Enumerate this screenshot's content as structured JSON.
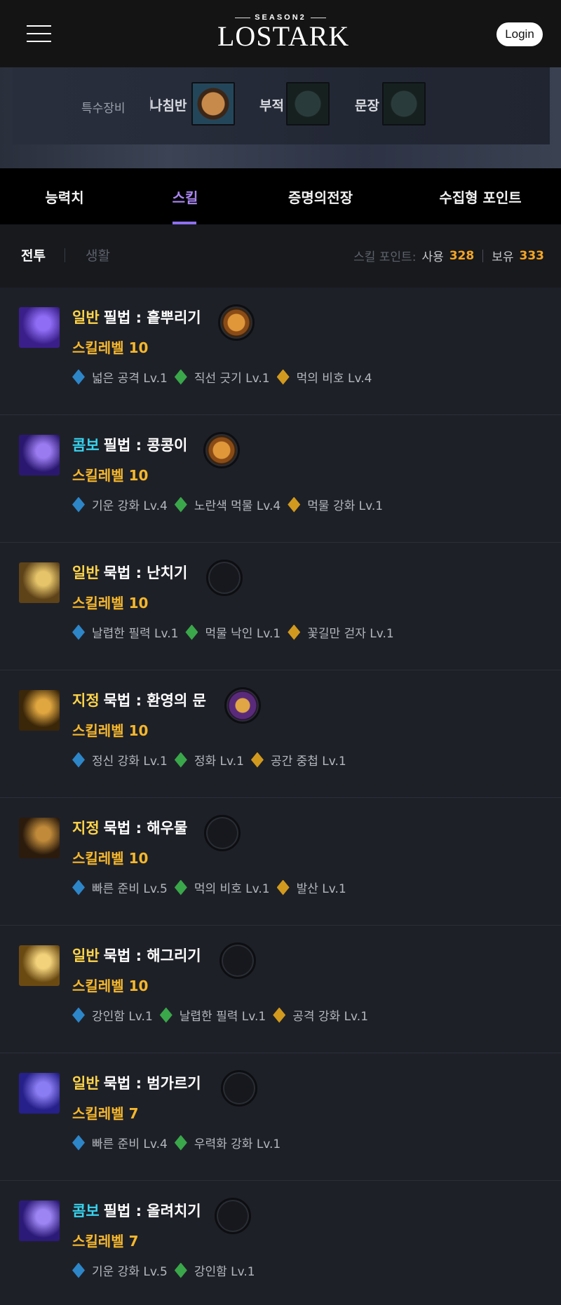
{
  "header": {
    "logo_season": "SEASON2",
    "logo_word": "LOSTARK",
    "login_label": "Login"
  },
  "equipment": {
    "special_label": "특수장비",
    "slots": [
      {
        "label": "나침반",
        "state": "filled"
      },
      {
        "label": "부적",
        "state": "empty"
      },
      {
        "label": "문장",
        "state": "empty"
      }
    ]
  },
  "tabs": [
    {
      "label": "능력치",
      "active": false
    },
    {
      "label": "스킬",
      "active": true
    },
    {
      "label": "증명의전장",
      "active": false
    },
    {
      "label": "수집형 포인트",
      "active": false
    }
  ],
  "subtabs": [
    {
      "label": "전투",
      "active": true
    },
    {
      "label": "생활",
      "active": false
    }
  ],
  "points": {
    "label": "스킬 포인트:",
    "used_label": "사용",
    "used_value": "328",
    "owned_label": "보유",
    "owned_value": "333"
  },
  "skills": [
    {
      "kind": "일반",
      "kind_color": "normal",
      "name": "필법 : 흩뿌리기",
      "level": "스킬레벨  10",
      "gem": "orange",
      "icon_colors": [
        "#3a1f8a",
        "#8f6df5"
      ],
      "tripods": [
        {
          "tier": "1",
          "text": "넓은 공격 Lv.1"
        },
        {
          "tier": "2",
          "text": "직선 긋기 Lv.1"
        },
        {
          "tier": "3",
          "text": "먹의 비호 Lv.4"
        }
      ]
    },
    {
      "kind": "콤보",
      "kind_color": "combo",
      "name": "필법 : 콩콩이",
      "level": "스킬레벨  10",
      "gem": "orange",
      "icon_colors": [
        "#2a1870",
        "#9b7bf0"
      ],
      "tripods": [
        {
          "tier": "1",
          "text": "기운 강화 Lv.4"
        },
        {
          "tier": "2",
          "text": "노란색 먹물 Lv.4"
        },
        {
          "tier": "3",
          "text": "먹물 강화 Lv.1"
        }
      ]
    },
    {
      "kind": "일반",
      "kind_color": "normal",
      "name": "묵법 : 난치기",
      "level": "스킬레벨  10",
      "gem": "empty",
      "icon_colors": [
        "#5e4218",
        "#e6c56a"
      ],
      "tripods": [
        {
          "tier": "1",
          "text": "날렵한 필력 Lv.1"
        },
        {
          "tier": "2",
          "text": "먹물 낙인 Lv.1"
        },
        {
          "tier": "3",
          "text": "꽃길만 걷자 Lv.1"
        }
      ]
    },
    {
      "kind": "지정",
      "kind_color": "target",
      "name": "묵법 : 환영의 문",
      "level": "스킬레벨  10",
      "gem": "purple",
      "icon_colors": [
        "#3a2608",
        "#e0a640"
      ],
      "tripods": [
        {
          "tier": "1",
          "text": "정신 강화 Lv.1"
        },
        {
          "tier": "2",
          "text": "정화 Lv.1"
        },
        {
          "tier": "3",
          "text": "공간 중첩 Lv.1"
        }
      ]
    },
    {
      "kind": "지정",
      "kind_color": "target",
      "name": "묵법 : 해우물",
      "level": "스킬레벨  10",
      "gem": "empty",
      "icon_colors": [
        "#2b1b0c",
        "#c08a3a"
      ],
      "tripods": [
        {
          "tier": "1",
          "text": "빠른 준비 Lv.5"
        },
        {
          "tier": "2",
          "text": "먹의 비호 Lv.1"
        },
        {
          "tier": "3",
          "text": "발산 Lv.1"
        }
      ]
    },
    {
      "kind": "일반",
      "kind_color": "normal",
      "name": "묵법 : 해그리기",
      "level": "스킬레벨  10",
      "gem": "empty",
      "icon_colors": [
        "#6b4a12",
        "#f2d27a"
      ],
      "tripods": [
        {
          "tier": "1",
          "text": "강인함 Lv.1"
        },
        {
          "tier": "2",
          "text": "날렵한 필력 Lv.1"
        },
        {
          "tier": "3",
          "text": "공격 강화 Lv.1"
        }
      ]
    },
    {
      "kind": "일반",
      "kind_color": "normal",
      "name": "묵법 : 범가르기",
      "level": "스킬레벨  7",
      "gem": "empty",
      "icon_colors": [
        "#26208a",
        "#8a7cf2"
      ],
      "tripods": [
        {
          "tier": "1",
          "text": "빠른 준비 Lv.4"
        },
        {
          "tier": "2",
          "text": "우력화 강화 Lv.1"
        }
      ]
    },
    {
      "kind": "콤보",
      "kind_color": "combo",
      "name": "필법 : 올려치기",
      "level": "스킬레벨  7",
      "gem": "empty",
      "icon_colors": [
        "#2c1a78",
        "#9d85f3"
      ],
      "tripods": [
        {
          "tier": "1",
          "text": "기운 강화 Lv.5"
        },
        {
          "tier": "2",
          "text": "강인함 Lv.1"
        }
      ]
    }
  ]
}
